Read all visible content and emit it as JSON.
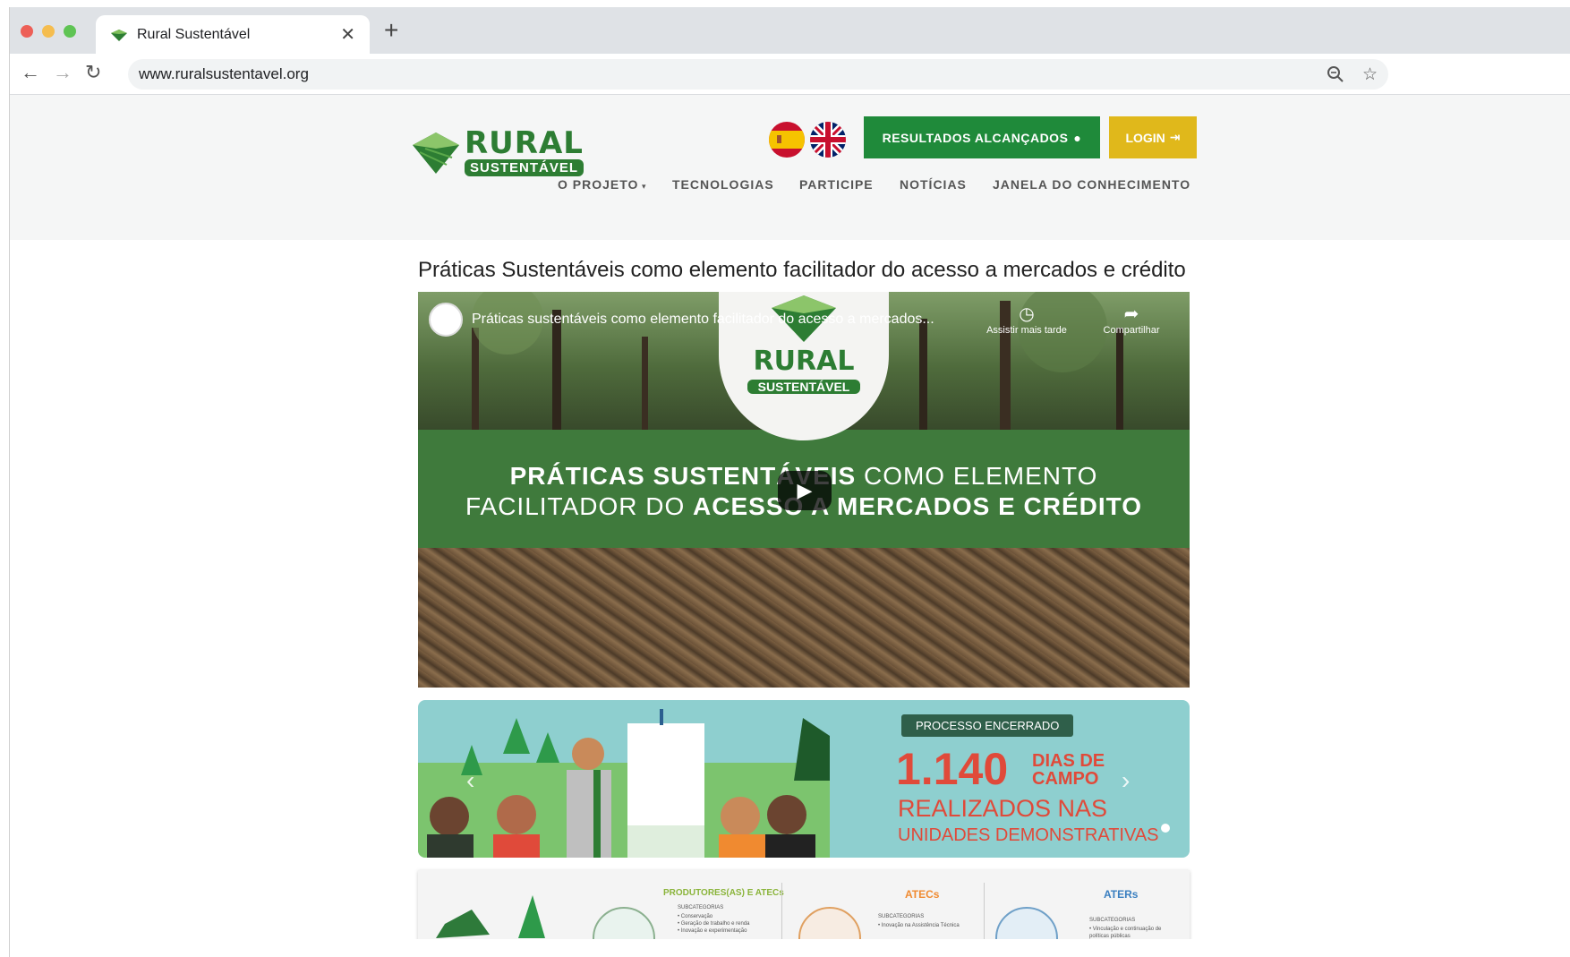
{
  "browser": {
    "tab_title": "Rural Sustentável",
    "url": "www.ruralsustentavel.org"
  },
  "header": {
    "logo_top": "RURAL",
    "logo_bottom": "SUSTENTÁVEL",
    "results_button": "RESULTADOS ALCANÇADOS",
    "login_button": "LOGIN",
    "menu": {
      "projeto": "O PROJETO",
      "tecnologias": "TECNOLOGIAS",
      "participe": "PARTICIPE",
      "noticias": "NOTÍCIAS",
      "janela": "JANELA DO CONHECIMENTO"
    }
  },
  "main": {
    "title": "Práticas Sustentáveis como elemento facilitador do acesso a mercados e crédito",
    "video": {
      "caption": "Práticas sustentáveis como elemento facilitador do acesso a mercados...",
      "watch_later": "Assistir mais tarde",
      "share": "Compartilhar",
      "logo_top": "RURAL",
      "logo_bottom": "SUSTENTÁVEL",
      "headline_line1_bold": "PRÁTICAS SUSTENTÁVEIS",
      "headline_line1_rest": " COMO ELEMENTO",
      "headline_line2_start": "FACILITADOR DO ",
      "headline_line2_bold": "ACESSO A MERCADOS E CRÉDITO"
    },
    "banner": {
      "badge": "PROCESSO ENCERRADO",
      "number": "1.140",
      "days_line1": "DIAS DE",
      "days_line2": "CAMPO",
      "line1": "REALIZADOS NAS",
      "line2": "UNIDADES DEMONSTRATIVAS"
    },
    "info": {
      "col1_title": "PRODUTORES(AS) E ATECs",
      "col1_sub_label": "SUBCATEGORIAS",
      "col1_items": "• Conservação\n• Geração de trabalho e renda\n• Inovação e experimentação",
      "col2_title": "ATECs",
      "col2_sub_label": "SUBCATEGORIAS",
      "col2_items": "• Inovação na Assistência Técnica",
      "col3_title": "ATERs",
      "col3_sub_label": "SUBCATEGORIAS",
      "col3_items": "• Vinculação e continuação de\npolíticas públicas"
    }
  },
  "colors": {
    "brand_green": "#2d7d33",
    "results_green": "#1f8a3a",
    "login_yellow": "#e0b81b",
    "banner_red": "#e04a3a",
    "banner_teal": "#8ecfcf"
  }
}
